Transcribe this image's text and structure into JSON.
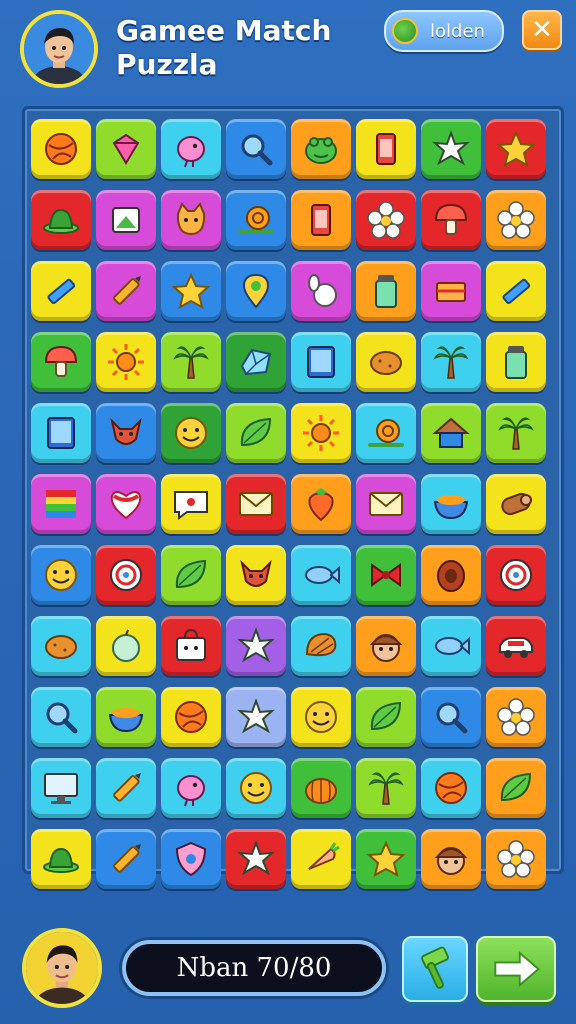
{
  "header": {
    "title_line1": "Gamee Match",
    "title_line2": "Puzzla",
    "pill_text": "lolden",
    "close_label": "✕"
  },
  "footer": {
    "score_text": "Nban  70/80"
  },
  "colors": {
    "yellow": "#f4e21a",
    "lime": "#8fdc2c",
    "cyan": "#3fd0ef",
    "blue": "#2e8ae6",
    "orange": "#ff9f1c",
    "red": "#e3272b",
    "green": "#3fbf3a",
    "magenta": "#d64bd8",
    "purple": "#a35fe6",
    "teal": "#30c9c3",
    "periwinkle": "#9bb3f2",
    "darkgreen": "#2fa335"
  },
  "board": {
    "rows": [
      [
        {
          "c": "yellow",
          "i": "ball-icon"
        },
        {
          "c": "lime",
          "i": "gem-icon"
        },
        {
          "c": "cyan",
          "i": "bird-icon"
        },
        {
          "c": "blue",
          "i": "magnifier-icon"
        },
        {
          "c": "orange",
          "i": "frog-icon"
        },
        {
          "c": "yellow",
          "i": "phone-icon"
        },
        {
          "c": "green",
          "i": "star-burst-icon"
        },
        {
          "c": "red",
          "i": "star-icon"
        }
      ],
      [
        {
          "c": "red",
          "i": "hat-icon"
        },
        {
          "c": "magenta",
          "i": "card-icon"
        },
        {
          "c": "magenta",
          "i": "cat-icon"
        },
        {
          "c": "blue",
          "i": "snail-icon"
        },
        {
          "c": "orange",
          "i": "phone-icon"
        },
        {
          "c": "red",
          "i": "flower-icon"
        },
        {
          "c": "red",
          "i": "mushroom-icon"
        },
        {
          "c": "orange",
          "i": "flower-icon"
        }
      ],
      [
        {
          "c": "yellow",
          "i": "pencil-icon"
        },
        {
          "c": "magenta",
          "i": "crayon-icon"
        },
        {
          "c": "blue",
          "i": "star-icon"
        },
        {
          "c": "blue",
          "i": "map-pin-icon"
        },
        {
          "c": "magenta",
          "i": "bowling-icon"
        },
        {
          "c": "orange",
          "i": "jar-icon"
        },
        {
          "c": "magenta",
          "i": "box-icon"
        },
        {
          "c": "yellow",
          "i": "pencil-icon"
        }
      ],
      [
        {
          "c": "green",
          "i": "mushroom-icon"
        },
        {
          "c": "yellow",
          "i": "sun-icon"
        },
        {
          "c": "lime",
          "i": "palm-tree-icon"
        },
        {
          "c": "darkgreen",
          "i": "crystal-icon"
        },
        {
          "c": "cyan",
          "i": "tablet-icon"
        },
        {
          "c": "yellow",
          "i": "potato-icon"
        },
        {
          "c": "cyan",
          "i": "palm-tree-icon"
        },
        {
          "c": "yellow",
          "i": "jar-icon"
        }
      ],
      [
        {
          "c": "cyan",
          "i": "tablet-icon"
        },
        {
          "c": "blue",
          "i": "fox-icon"
        },
        {
          "c": "darkgreen",
          "i": "smiley-icon"
        },
        {
          "c": "lime",
          "i": "leaf-icon"
        },
        {
          "c": "yellow",
          "i": "sun-icon"
        },
        {
          "c": "cyan",
          "i": "snail-icon"
        },
        {
          "c": "lime",
          "i": "hut-icon"
        },
        {
          "c": "lime",
          "i": "palm-tree-icon"
        }
      ],
      [
        {
          "c": "magenta",
          "i": "stripes-icon"
        },
        {
          "c": "magenta",
          "i": "heart-icon"
        },
        {
          "c": "yellow",
          "i": "chat-icon"
        },
        {
          "c": "red",
          "i": "envelope-icon"
        },
        {
          "c": "orange",
          "i": "strawberry-icon"
        },
        {
          "c": "magenta",
          "i": "envelope-icon"
        },
        {
          "c": "cyan",
          "i": "bowl-icon"
        },
        {
          "c": "yellow",
          "i": "log-icon"
        }
      ],
      [
        {
          "c": "blue",
          "i": "smiley-icon"
        },
        {
          "c": "red",
          "i": "target-icon"
        },
        {
          "c": "lime",
          "i": "leaf-icon"
        },
        {
          "c": "yellow",
          "i": "fox-icon"
        },
        {
          "c": "cyan",
          "i": "fish-icon"
        },
        {
          "c": "green",
          "i": "bow-icon"
        },
        {
          "c": "orange",
          "i": "egg-icon"
        },
        {
          "c": "red",
          "i": "target-icon"
        }
      ],
      [
        {
          "c": "cyan",
          "i": "potato-icon"
        },
        {
          "c": "yellow",
          "i": "apple-icon"
        },
        {
          "c": "red",
          "i": "bag-icon"
        },
        {
          "c": "purple",
          "i": "star-burst-icon"
        },
        {
          "c": "cyan",
          "i": "shell-icon"
        },
        {
          "c": "orange",
          "i": "face-icon"
        },
        {
          "c": "cyan",
          "i": "fish-icon"
        },
        {
          "c": "red",
          "i": "car-icon"
        }
      ],
      [
        {
          "c": "cyan",
          "i": "magnifier-icon"
        },
        {
          "c": "lime",
          "i": "bowl-icon"
        },
        {
          "c": "yellow",
          "i": "ball-icon"
        },
        {
          "c": "periwinkle",
          "i": "star-burst-icon"
        },
        {
          "c": "yellow",
          "i": "smiley-icon"
        },
        {
          "c": "lime",
          "i": "leaf-icon"
        },
        {
          "c": "blue",
          "i": "magnifier-icon"
        },
        {
          "c": "orange",
          "i": "flower-icon"
        }
      ],
      [
        {
          "c": "cyan",
          "i": "monitor-icon"
        },
        {
          "c": "cyan",
          "i": "crayon-icon"
        },
        {
          "c": "cyan",
          "i": "bird-icon"
        },
        {
          "c": "cyan",
          "i": "smiley-icon"
        },
        {
          "c": "green",
          "i": "pumpkin-icon"
        },
        {
          "c": "lime",
          "i": "palm-tree-icon"
        },
        {
          "c": "cyan",
          "i": "ball-icon"
        },
        {
          "c": "orange",
          "i": "leaf-icon"
        }
      ],
      [
        {
          "c": "yellow",
          "i": "hat-icon"
        },
        {
          "c": "blue",
          "i": "crayon-icon"
        },
        {
          "c": "blue",
          "i": "shield-icon"
        },
        {
          "c": "red",
          "i": "star-burst-icon"
        },
        {
          "c": "yellow",
          "i": "carrot-icon"
        },
        {
          "c": "green",
          "i": "star-icon"
        },
        {
          "c": "orange",
          "i": "face-icon"
        },
        {
          "c": "orange",
          "i": "flower-icon"
        }
      ]
    ]
  }
}
